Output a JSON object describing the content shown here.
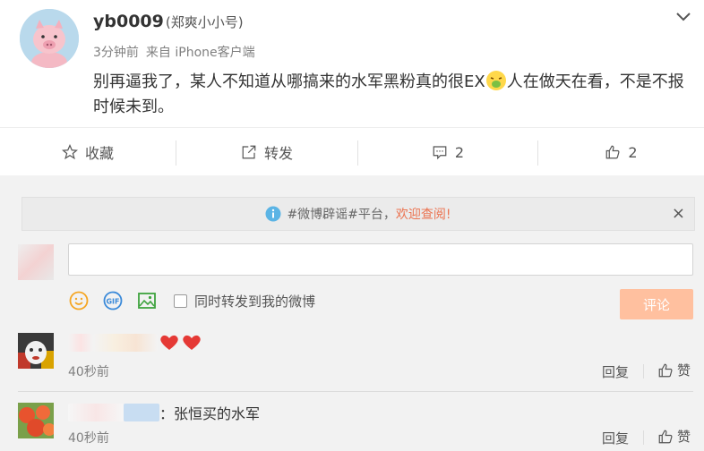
{
  "post": {
    "username": "yb0009",
    "alias": "(郑爽小小号)",
    "time": "3分钟前",
    "source": "来自 iPhone客户端",
    "text_before_emoji": "别再逼我了，某人不知道从哪搞来的水军黑粉真的很EX",
    "text_after_emoji": "人在做天在看，不是不报时候未到。"
  },
  "actions": {
    "favorite": "收藏",
    "forward": "转发",
    "comment_count": "2",
    "like_count": "2"
  },
  "notice": {
    "text": "#微博辟谣#平台，",
    "link": "欢迎查阅!",
    "close": "×"
  },
  "composer": {
    "checkbox_label": "同时转发到我的微博",
    "submit": "评论",
    "gif_label": "GIF"
  },
  "comments": [
    {
      "text": "",
      "time": "40秒前",
      "reply": "回复",
      "like": "赞"
    },
    {
      "text": "：张恒买的水军",
      "time": "40秒前",
      "reply": "回复",
      "like": "赞"
    }
  ],
  "colors": {
    "accent": "#eb7350",
    "submit_bg": "#ffc09f",
    "heart": "#e53935"
  }
}
